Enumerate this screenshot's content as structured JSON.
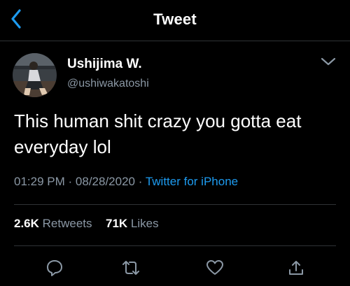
{
  "header": {
    "title": "Tweet"
  },
  "author": {
    "name": "Ushijima W.",
    "handle": "@ushiwakatoshi"
  },
  "tweet": {
    "text": "This human shit crazy you gotta eat everyday lol",
    "time": "01:29 PM",
    "date": "08/28/2020",
    "source": "Twitter for iPhone",
    "separator": "·"
  },
  "stats": {
    "retweets_count": "2.6K",
    "retweets_label": "Retweets",
    "likes_count": "71K",
    "likes_label": "Likes"
  },
  "icons": {
    "back": "chevron-left-icon",
    "more": "chevron-down-icon",
    "reply": "reply-icon",
    "retweet": "retweet-icon",
    "like": "heart-icon",
    "share": "share-icon"
  },
  "colors": {
    "background": "#000000",
    "text": "#ffffff",
    "secondary": "#8b98a5",
    "accent": "#1d9bf0",
    "divider": "#2f3336"
  }
}
